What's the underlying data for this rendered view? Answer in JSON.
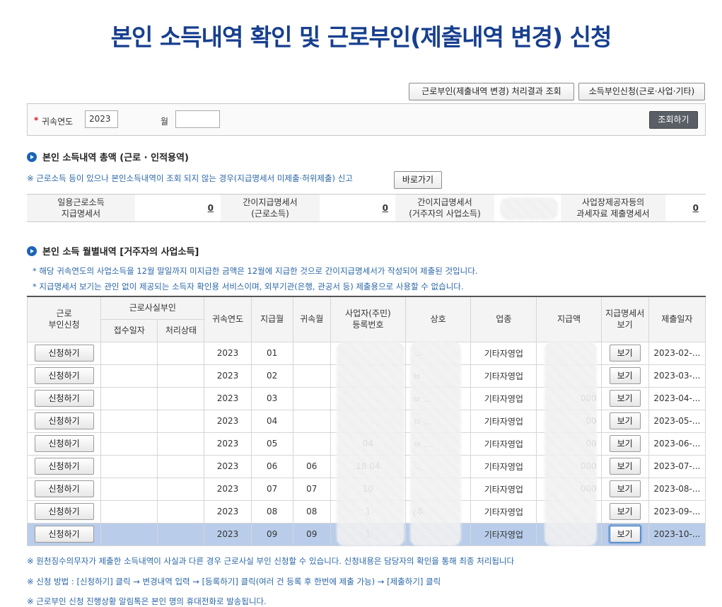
{
  "title": "본인 소득내역 확인 및 근로부인(제출내역 변경) 신청",
  "top_buttons": {
    "result_query": "근로부인(제출내역 변경) 처리결과 조회",
    "income_request": "소득부인신청(근로·사업·기타)"
  },
  "search": {
    "star": "*",
    "year_label": "귀속연도",
    "year_value": "2023",
    "month_label": "월",
    "month_value": "",
    "query_button": "조회하기"
  },
  "summary_section": {
    "heading": "본인 소득내역 총액  (근로 · 인적용역)",
    "note": "※ 근로소득 등이 있으나 본인소득내역이 조회 되지 않는 경우(지급명세서 미제출·허위제출) 신고",
    "goto_button": "바로가기",
    "items": [
      {
        "label": "일용근로소득\n지급명세서",
        "value": "0"
      },
      {
        "label": "간이지급명세서\n(근로소득)",
        "value": "0"
      },
      {
        "label": "간이지급명세서\n(거주자의 사업소득)",
        "value": ""
      },
      {
        "label": "사업장제공자등의\n과세자료 제출명세서",
        "value": "0"
      }
    ]
  },
  "monthly_section": {
    "heading": "본인 소득 월별내역 [거주자의 사업소득]",
    "note1": "* 해당 귀속연도의 사업소득을 12월 말일까지 미지급한 금액은 12월에 지급한 것으로 간이지급명세서가 작성되어 제출된 것입니다.",
    "note2": "* 지급명세서 보기는 관인 없이 제공되는 소득자 확인용 서비스이며, 외부기관(은행, 관공서 등) 제출용으로 사용할 수 없습니다."
  },
  "table": {
    "headers": {
      "deny": "근로\n부인신청",
      "fact_deny": "근로사실부인",
      "receipt_date": "접수일자",
      "process_status": "처리상태",
      "year": "귀속연도",
      "pay_month": "지급월",
      "attr_month": "귀속월",
      "biz_no": "사업자(주민)\n등록번호",
      "company": "상호",
      "industry": "업종",
      "amount": "지급액",
      "statement": "지급명세서\n보기",
      "submit_date": "제출일자"
    },
    "apply_label": "신청하기",
    "view_label": "보기",
    "rows": [
      {
        "year": "2023",
        "pay_month": "01",
        "attr_month": "",
        "biz_no": "",
        "company": "...",
        "industry": "기타자영업",
        "amount": "",
        "submit_date": "2023-02-..."
      },
      {
        "year": "2023",
        "pay_month": "02",
        "attr_month": "",
        "biz_no": "",
        "company": "ㅂ",
        "industry": "기타자영업",
        "amount": "",
        "submit_date": "2023-03-..."
      },
      {
        "year": "2023",
        "pay_month": "03",
        "attr_month": "",
        "biz_no": "",
        "company": "ㅂ ...",
        "industry": "기타자영업",
        "amount": "000",
        "submit_date": "2023-04-..."
      },
      {
        "year": "2023",
        "pay_month": "04",
        "attr_month": "",
        "biz_no": "",
        "company": "ㅂ ...",
        "industry": "기타자영업",
        "amount": "00",
        "submit_date": "2023-05-..."
      },
      {
        "year": "2023",
        "pay_month": "05",
        "attr_month": "",
        "biz_no": "04",
        "company": "ㅂ ...",
        "industry": "기타자영업",
        "amount": "00",
        "submit_date": "2023-06-..."
      },
      {
        "year": "2023",
        "pay_month": "06",
        "attr_month": "06",
        "biz_no": "18 04",
        "company": "...",
        "industry": "기타자영업",
        "amount": "000",
        "submit_date": "2023-07-..."
      },
      {
        "year": "2023",
        "pay_month": "07",
        "attr_month": "07",
        "biz_no": "10",
        "company": "",
        "industry": "기타자영업",
        "amount": "000",
        "submit_date": "2023-08-..."
      },
      {
        "year": "2023",
        "pay_month": "08",
        "attr_month": "08",
        "biz_no": "1",
        "company": "(주",
        "industry": "기타자영업",
        "amount": "",
        "submit_date": "2023-09-..."
      },
      {
        "year": "2023",
        "pay_month": "09",
        "attr_month": "09",
        "biz_no": "1",
        "company": "",
        "industry": "기타자영업",
        "amount": "",
        "submit_date": "2023-10-..."
      }
    ]
  },
  "footnotes": [
    "※ 원천징수의무자가 제출한 소득내역이 사실과 다른 경우 근로사실 부인 신청할 수 있습니다. 신청내용은 담당자의 확인을 통해 최종 처리됩니다",
    "※ 신청 방법 : [신청하기] 클릭 → 변경내역 입력 → [등록하기] 클릭(여러 건 등록 후 한번에 제출 가능) → [제출하기] 클릭",
    "※ 근로부인 신청 진행상황 알림톡은 본인 명의 휴대전화로 발송됩니다."
  ]
}
